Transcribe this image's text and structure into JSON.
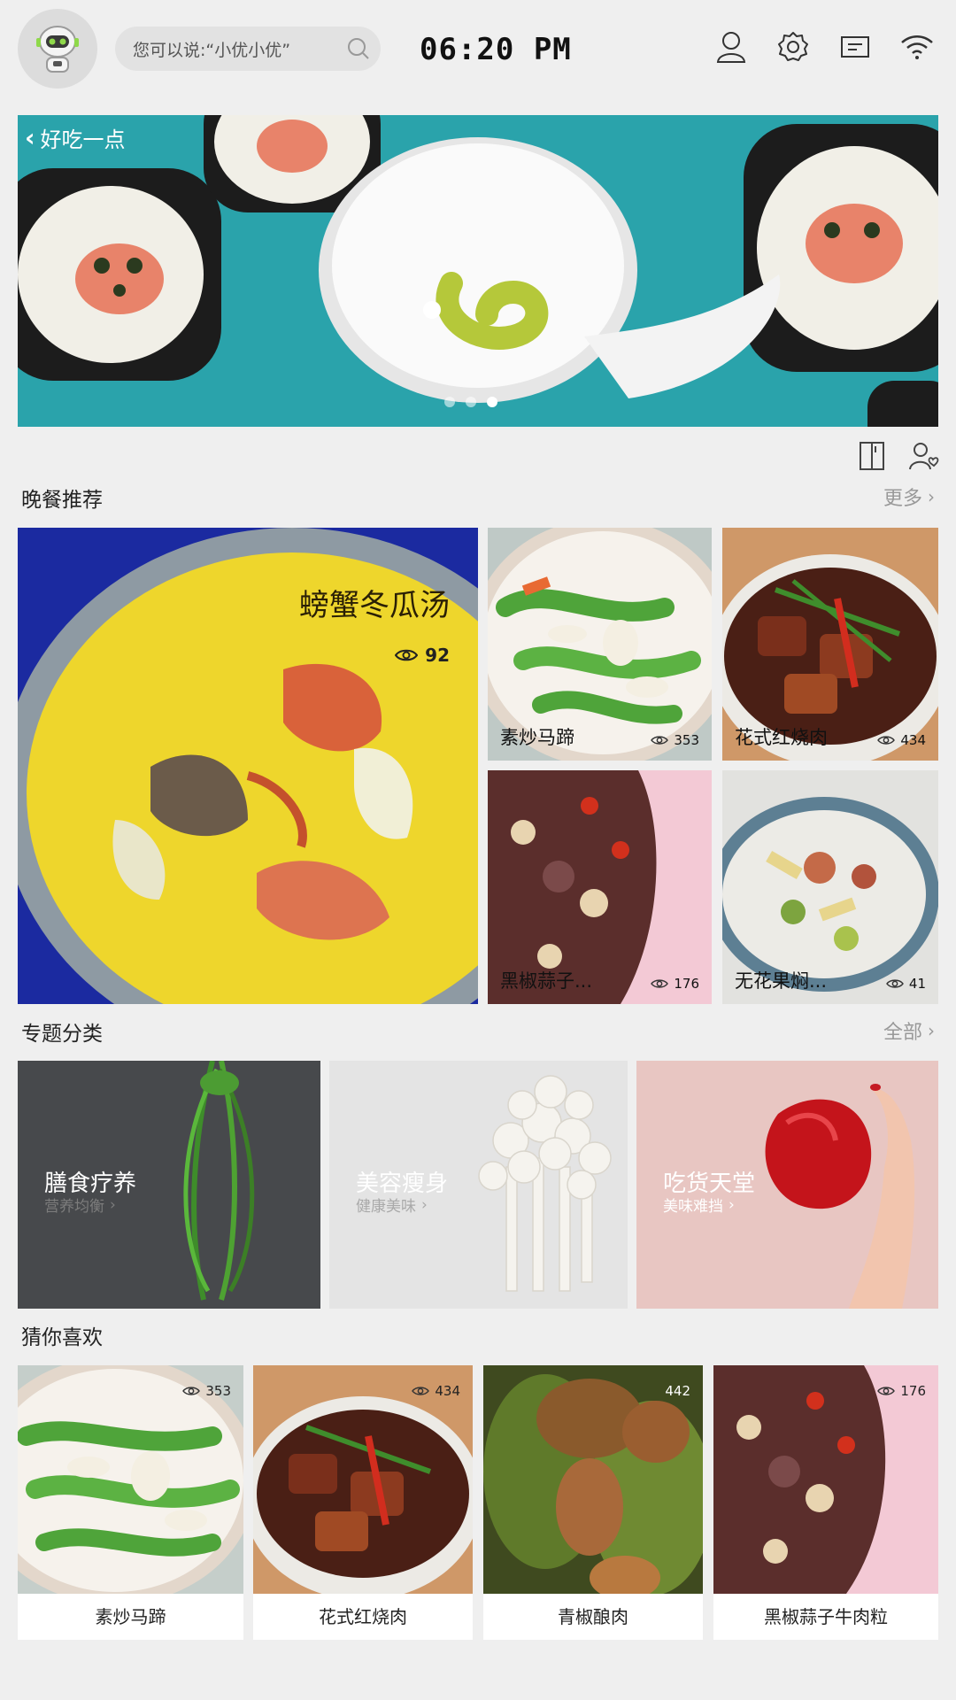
{
  "header": {
    "search_placeholder": "您可以说:“小优小优”",
    "time": "06:20 PM",
    "icons": [
      "robot-avatar-icon",
      "search-icon",
      "user-icon",
      "settings-icon",
      "message-icon",
      "wifi-icon"
    ]
  },
  "banner": {
    "back_label": "好吃一点",
    "slide_count": 3,
    "active_slide": 3
  },
  "dinner": {
    "title": "晚餐推荐",
    "more": "更多",
    "featured": {
      "name": "螃蟹冬瓜汤",
      "views": "92"
    },
    "items": [
      {
        "name": "素炒马蹄",
        "views": "353"
      },
      {
        "name": "花式红烧肉",
        "views": "434"
      },
      {
        "name": "黑椒蒜子...",
        "views": "176"
      },
      {
        "name": "无花果焖...",
        "views": "41"
      }
    ]
  },
  "topics": {
    "title": "专题分类",
    "more": "全部",
    "items": [
      {
        "name": "膳食疗养",
        "sub": "营养均衡"
      },
      {
        "name": "美容瘦身",
        "sub": "健康美味"
      },
      {
        "name": "吃货天堂",
        "sub": "美味难挡"
      }
    ]
  },
  "guess": {
    "title": "猜你喜欢",
    "items": [
      {
        "name": "素炒马蹄",
        "views": "353"
      },
      {
        "name": "花式红烧肉",
        "views": "434"
      },
      {
        "name": "青椒酿肉",
        "views": "442"
      },
      {
        "name": "黑椒蒜子牛肉粒",
        "views": "176"
      }
    ]
  },
  "colors": {
    "background": "#efefef",
    "banner_teal": "#2aa3ab",
    "topic_dark": "#47494c",
    "topic_light": "#e4e4e4",
    "topic_pink": "#e8c6c2"
  }
}
